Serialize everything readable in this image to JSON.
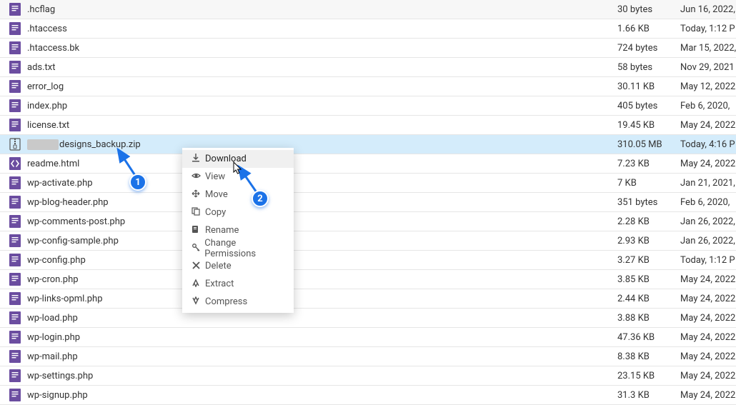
{
  "colors": {
    "selected_row_bg": "#d4ecfb",
    "marker_bg": "#1b72e8",
    "icon_purple": "#6b4da0"
  },
  "files": [
    {
      "name": ".hcflag",
      "size": "30 bytes",
      "modified": "Jun 16, 2022,",
      "icon": "doc"
    },
    {
      "name": ".htaccess",
      "size": "1.66 KB",
      "modified": "Today, 1:12 P",
      "icon": "doc"
    },
    {
      "name": ".htaccess.bk",
      "size": "724 bytes",
      "modified": "Mar 15, 2022,",
      "icon": "doc"
    },
    {
      "name": "ads.txt",
      "size": "58 bytes",
      "modified": "Nov 29, 2021",
      "icon": "doc"
    },
    {
      "name": "error_log",
      "size": "30.11 KB",
      "modified": "May 12, 2022",
      "icon": "doc"
    },
    {
      "name": "index.php",
      "size": "405 bytes",
      "modified": "Feb 6, 2020, ",
      "icon": "doc"
    },
    {
      "name": "license.txt",
      "size": "19.45 KB",
      "modified": "May 24, 2022",
      "icon": "doc"
    },
    {
      "name": "designs_backup.zip",
      "prefix_redacted": true,
      "size": "310.05 MB",
      "modified": "Today, 4:16 P",
      "icon": "zip",
      "selected": true
    },
    {
      "name": "readme.html",
      "size": "7.23 KB",
      "modified": "May 24, 2022",
      "icon": "html"
    },
    {
      "name": "wp-activate.php",
      "size": "7 KB",
      "modified": "Jan 21, 2021,",
      "icon": "doc"
    },
    {
      "name": "wp-blog-header.php",
      "size": "351 bytes",
      "modified": "Feb 6, 2020, ",
      "icon": "doc"
    },
    {
      "name": "wp-comments-post.php",
      "size": "2.28 KB",
      "modified": "Jan 26, 2022,",
      "icon": "doc"
    },
    {
      "name": "wp-config-sample.php",
      "size": "2.93 KB",
      "modified": "Jan 26, 2022,",
      "icon": "doc"
    },
    {
      "name": "wp-config.php",
      "size": "3.27 KB",
      "modified": "Today, 1:12 P",
      "icon": "doc"
    },
    {
      "name": "wp-cron.php",
      "size": "3.85 KB",
      "modified": "May 24, 2022",
      "icon": "doc"
    },
    {
      "name": "wp-links-opml.php",
      "size": "2.44 KB",
      "modified": "May 24, 2022",
      "icon": "doc"
    },
    {
      "name": "wp-load.php",
      "size": "3.88 KB",
      "modified": "May 24, 2022",
      "icon": "doc"
    },
    {
      "name": "wp-login.php",
      "size": "47.36 KB",
      "modified": "May 24, 2022",
      "icon": "doc"
    },
    {
      "name": "wp-mail.php",
      "size": "8.38 KB",
      "modified": "May 24, 2022",
      "icon": "doc"
    },
    {
      "name": "wp-settings.php",
      "size": "23.15 KB",
      "modified": "May 24, 2022",
      "icon": "doc"
    },
    {
      "name": "wp-signup.php",
      "size": "31.3 KB",
      "modified": "May 24, 2022",
      "icon": "doc"
    }
  ],
  "context_menu": {
    "items": [
      {
        "label": "Download",
        "icon": "download",
        "hovered": true
      },
      {
        "label": "View",
        "icon": "eye"
      },
      {
        "label": "Move",
        "icon": "move"
      },
      {
        "label": "Copy",
        "icon": "copy"
      },
      {
        "label": "Rename",
        "icon": "rename"
      },
      {
        "label": "Change Permissions",
        "icon": "key"
      },
      {
        "label": "Delete",
        "icon": "delete"
      },
      {
        "label": "Extract",
        "icon": "extract"
      },
      {
        "label": "Compress",
        "icon": "compress"
      }
    ]
  },
  "markers": {
    "m1": "1",
    "m2": "2"
  }
}
